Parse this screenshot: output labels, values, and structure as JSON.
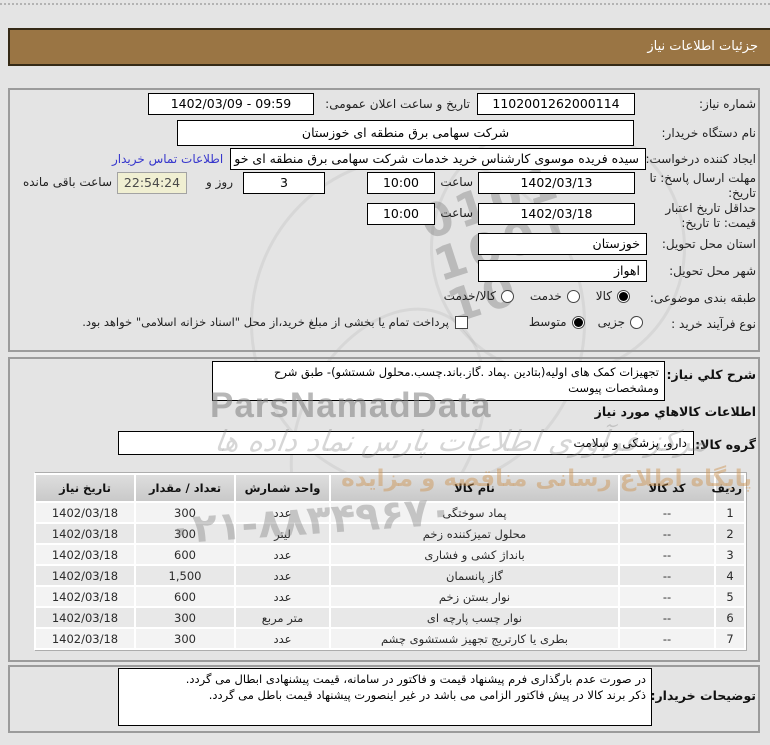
{
  "page": {
    "title": "جزئیات اطلاعات نیاز"
  },
  "info": {
    "need_number": {
      "label": "شماره نیاز:",
      "value": "1102001262000114"
    },
    "announce": {
      "label": "تاریخ و ساعت اعلان عمومی:",
      "value": "1402/03/09 - 09:59"
    },
    "buyer_org": {
      "label": "نام دستگاه خریدار:",
      "value": "شرکت سهامی برق منطقه ای خوزستان"
    },
    "requester": {
      "label": "ایجاد کننده درخواست:",
      "value": "سیده فریده موسوی کارشناس خرید خدمات شرکت سهامی برق منطقه ای خو",
      "contact_link": "اطلاعات تماس خریدار"
    },
    "deadline": {
      "label": "مهلت ارسال پاسخ: تا تاریخ:",
      "date": "1402/03/13",
      "hour_label": "ساعت",
      "time": "10:00",
      "days": "3",
      "days_label": "روز و",
      "remaining": "22:54:24",
      "remaining_label": "ساعت باقی مانده"
    },
    "validity": {
      "label": "حداقل تاریخ اعتبار قیمت: تا تاریخ:",
      "date": "1402/03/18",
      "hour_label": "ساعت",
      "time": "10:00"
    },
    "province": {
      "label": "استان محل تحویل:",
      "value": "خوزستان"
    },
    "city": {
      "label": "شهر محل تحویل:",
      "value": "اهواز"
    },
    "category": {
      "label": "طبقه بندی موضوعی:",
      "options": [
        {
          "label": "کالا",
          "selected": true
        },
        {
          "label": "خدمت",
          "selected": false
        },
        {
          "label": "کالا/خدمت",
          "selected": false
        }
      ]
    },
    "process": {
      "label": "نوع فرآیند خرید :",
      "options": [
        {
          "label": "جزیی",
          "selected": false
        },
        {
          "label": "متوسط",
          "selected": true
        }
      ],
      "treasury_checkbox": "پرداخت تمام یا بخشی از مبلغ خرید،از محل \"اسناد خزانه اسلامی\" خواهد بود."
    }
  },
  "need": {
    "desc_label": "شرح کلي نیاز:",
    "desc": "تجهیزات کمک های اولیه(بتادین .پماد .گاز.باند.چسب.محلول شستشو)- طبق شرح ومشخصات پیوست",
    "goods_heading": "اطلاعات کالاهاي مورد نیاز",
    "group_label": "گروه کالا:",
    "group_value": "دارو، پزشکی و سلامت"
  },
  "goods_table": {
    "headers": [
      "ردیف",
      "کد کالا",
      "نام کالا",
      "واحد شمارش",
      "تعداد / مقدار",
      "تاریخ نیاز"
    ],
    "keys": [
      "row",
      "code",
      "name",
      "unit",
      "qty",
      "date"
    ],
    "rows": [
      {
        "row": "1",
        "code": "--",
        "name": "پماد سوختگی",
        "unit": "عدد",
        "qty": "300",
        "date": "1402/03/18"
      },
      {
        "row": "2",
        "code": "--",
        "name": "محلول تمیزکننده زخم",
        "unit": "لیتر",
        "qty": "300",
        "date": "1402/03/18"
      },
      {
        "row": "3",
        "code": "--",
        "name": "بانداژ کشی و فشاری",
        "unit": "عدد",
        "qty": "600",
        "date": "1402/03/18"
      },
      {
        "row": "4",
        "code": "--",
        "name": "گاز پانسمان",
        "unit": "عدد",
        "qty": "1,500",
        "date": "1402/03/18"
      },
      {
        "row": "5",
        "code": "--",
        "name": "نوار بستن زخم",
        "unit": "عدد",
        "qty": "600",
        "date": "1402/03/18"
      },
      {
        "row": "6",
        "code": "--",
        "name": "نوار چسب پارچه ای",
        "unit": "متر مربع",
        "qty": "300",
        "date": "1402/03/18"
      },
      {
        "row": "7",
        "code": "--",
        "name": "بطری یا کارتریج تجهیز شستشوی چشم",
        "unit": "عدد",
        "qty": "300",
        "date": "1402/03/18"
      }
    ]
  },
  "buyer_notes": {
    "label": "توضیحات خریدار:",
    "line1": "در صورت عدم بارگذاری فرم پیشنهاد قیمت و فاکتور در سامانه، قیمت پیشنهادی ابطال می گردد.",
    "line2": "ذکر برند کالا در پیش فاکتور الزامی می باشد در غیر اینصورت پیشنهاد قیمت باطل می گردد."
  },
  "watermarks": {
    "brand": "ParsNamadData",
    "cursive": "مرکز فرآوری اطلاعات پارس نماد داده ها",
    "tagline": "پایگاه اطلاع رسانی مناقصه و مزایده",
    "phone": "۰۲۱-۸۸۳۴۹۶۷۰",
    "digits_1": "0101",
    "digits_2": "1001",
    "digits_3": "10"
  },
  "colors": {
    "header_bg": "#9a7544",
    "link": "#3636cc",
    "remaining_bg": "#f0efd2"
  }
}
